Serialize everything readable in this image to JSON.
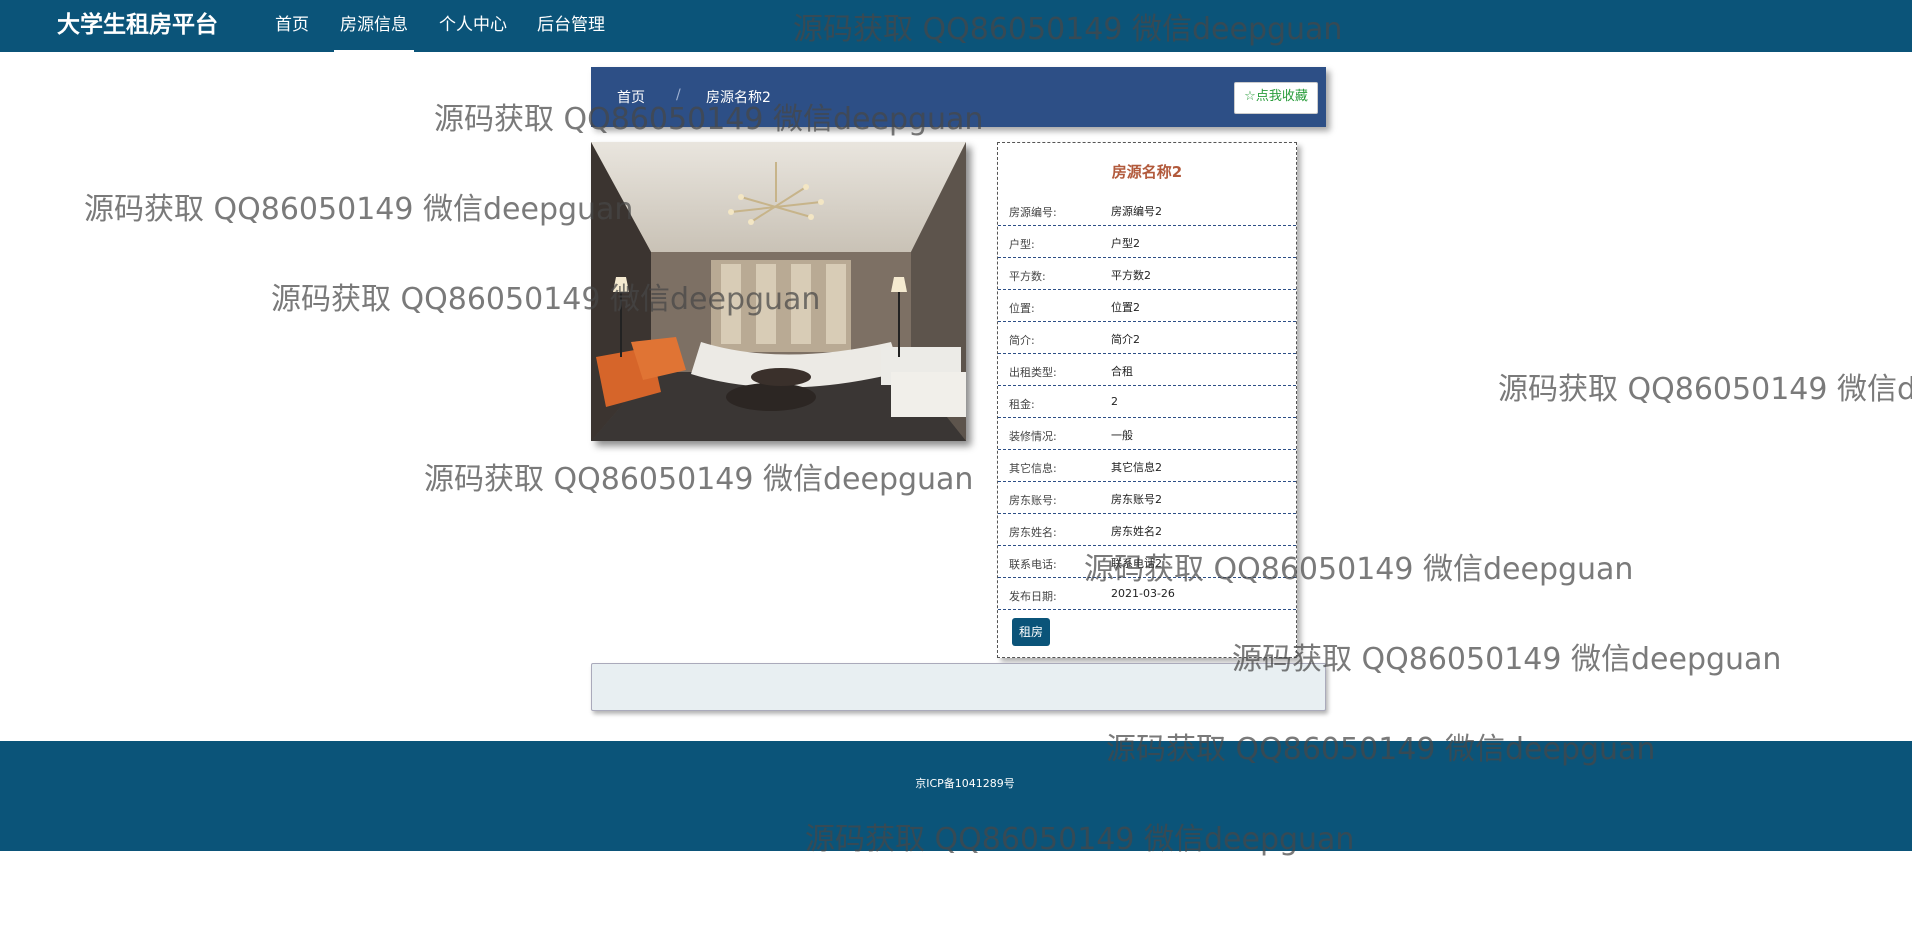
{
  "navbar": {
    "brand": "大学生租房平台",
    "items": [
      {
        "label": "首页",
        "active": false
      },
      {
        "label": "房源信息",
        "active": true
      },
      {
        "label": "个人中心",
        "active": false
      },
      {
        "label": "后台管理",
        "active": false
      }
    ]
  },
  "breadcrumb": {
    "home": "首页",
    "separator": "/",
    "current": "房源名称2"
  },
  "favorite_button": "☆点我收藏",
  "detail": {
    "title": "房源名称2",
    "rows": [
      {
        "key": "房源编号:",
        "value": "房源编号2"
      },
      {
        "key": "户型:",
        "value": "户型2"
      },
      {
        "key": "平方数:",
        "value": "平方数2"
      },
      {
        "key": "位置:",
        "value": "位置2"
      },
      {
        "key": "简介:",
        "value": "简介2"
      },
      {
        "key": "出租类型:",
        "value": "合租"
      },
      {
        "key": "租金:",
        "value": "2"
      },
      {
        "key": "装修情况:",
        "value": "一般"
      },
      {
        "key": "其它信息:",
        "value": "其它信息2"
      },
      {
        "key": "房东账号:",
        "value": "房东账号2"
      },
      {
        "key": "房东姓名:",
        "value": "房东姓名2"
      },
      {
        "key": "联系电话:",
        "value": "联系电话2"
      },
      {
        "key": "发布日期:",
        "value": "2021-03-26"
      }
    ],
    "rent_button": "租房"
  },
  "footer": {
    "icp": "京ICP备1041289号"
  },
  "watermark": "源码获取 QQ86050149 微信deepguan",
  "colors": {
    "navbar": "#0b5479",
    "breadcrumb_bar": "#2d4f86",
    "title_accent": "#b25a3c",
    "favorite_text": "#2a9d3c"
  }
}
